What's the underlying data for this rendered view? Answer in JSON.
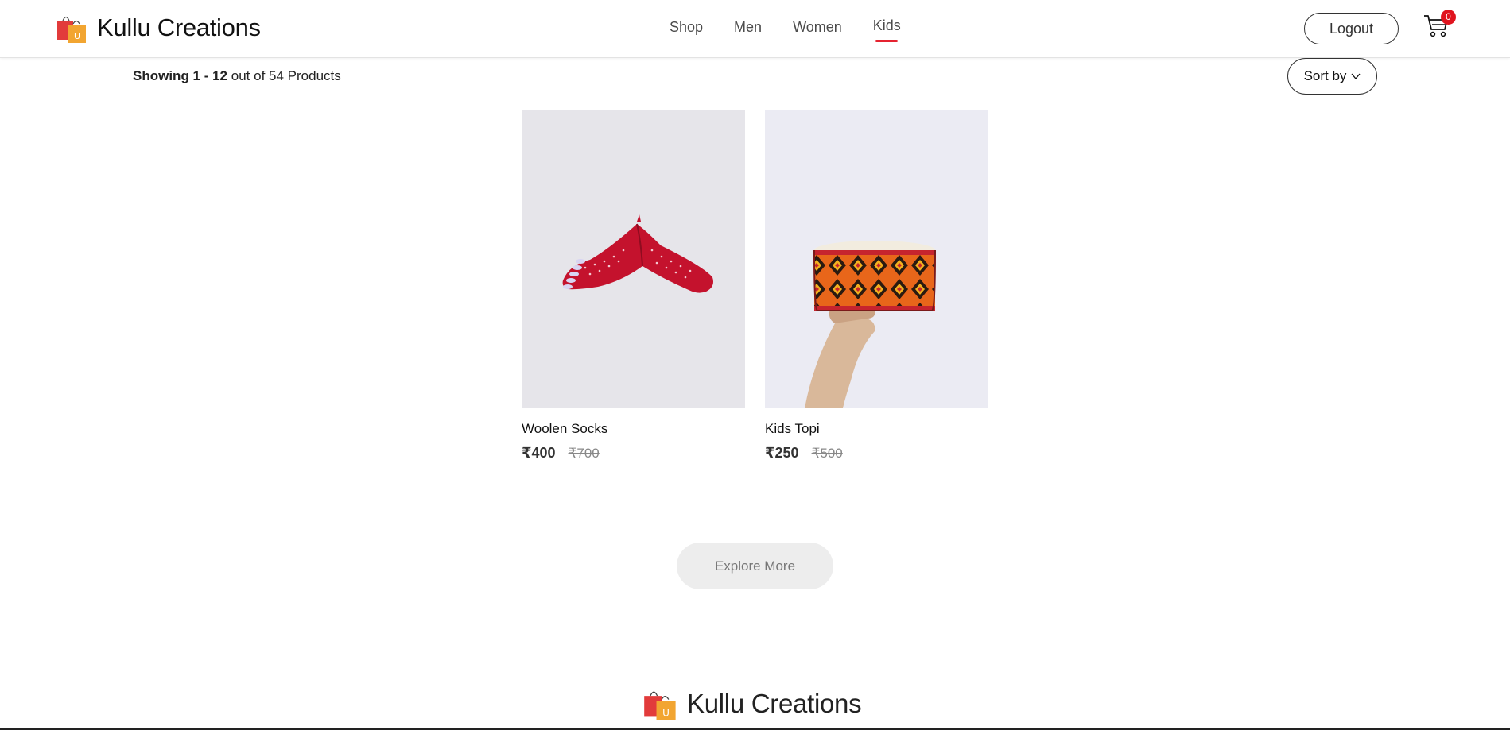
{
  "header": {
    "brand_name": "Kullu Creations",
    "nav": [
      {
        "label": "Shop",
        "active": false
      },
      {
        "label": "Men",
        "active": false
      },
      {
        "label": "Women",
        "active": false
      },
      {
        "label": "Kids",
        "active": true
      }
    ],
    "logout_label": "Logout",
    "cart_count": "0"
  },
  "toolbar": {
    "showing_bold": "Showing 1 - 12",
    "showing_rest": "out of 54 Products",
    "sort_label": "Sort by"
  },
  "products": [
    {
      "name": "Woolen Socks",
      "price": "₹400",
      "old_price": "₹700",
      "image_icon": "woolen-socks"
    },
    {
      "name": "Kids Topi",
      "price": "₹250",
      "old_price": "₹500",
      "image_icon": "kids-topi"
    }
  ],
  "explore_label": "Explore More",
  "footer": {
    "brand_name": "Kullu Creations"
  },
  "colors": {
    "accent": "#e52330",
    "badge": "#e0141e",
    "bag_red": "#e23b3b",
    "bag_yellow": "#f2a531"
  }
}
